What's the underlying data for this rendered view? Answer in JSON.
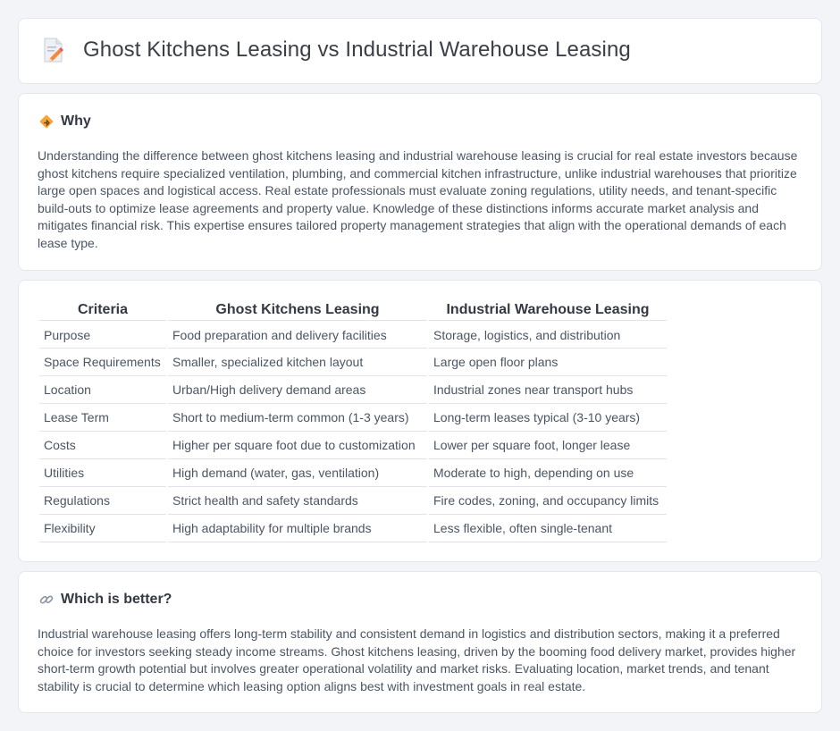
{
  "header": {
    "title": "Ghost Kitchens Leasing vs Industrial Warehouse Leasing",
    "icon": "document-pencil-icon"
  },
  "why": {
    "heading": "Why",
    "icon": "diamond-road-sign-icon",
    "text": "Understanding the difference between ghost kitchens leasing and industrial warehouse leasing is crucial for real estate investors because ghost kitchens require specialized ventilation, plumbing, and commercial kitchen infrastructure, unlike industrial warehouses that prioritize large open spaces and logistical access. Real estate professionals must evaluate zoning regulations, utility needs, and tenant-specific build-outs to optimize lease agreements and property value. Knowledge of these distinctions informs accurate market analysis and mitigates financial risk. This expertise ensures tailored property management strategies that align with the operational demands of each lease type."
  },
  "comparison": {
    "headers": [
      "Criteria",
      "Ghost Kitchens Leasing",
      "Industrial Warehouse Leasing"
    ],
    "rows": [
      [
        "Purpose",
        "Food preparation and delivery facilities",
        "Storage, logistics, and distribution"
      ],
      [
        "Space Requirements",
        "Smaller, specialized kitchen layout",
        "Large open floor plans"
      ],
      [
        "Location",
        "Urban/High delivery demand areas",
        "Industrial zones near transport hubs"
      ],
      [
        "Lease Term",
        "Short to medium-term common (1-3 years)",
        "Long-term leases typical (3-10 years)"
      ],
      [
        "Costs",
        "Higher per square foot due to customization",
        "Lower per square foot, longer lease"
      ],
      [
        "Utilities",
        "High demand (water, gas, ventilation)",
        "Moderate to high, depending on use"
      ],
      [
        "Regulations",
        "Strict health and safety standards",
        "Fire codes, zoning, and occupancy limits"
      ],
      [
        "Flexibility",
        "High adaptability for multiple brands",
        "Less flexible, often single-tenant"
      ]
    ]
  },
  "better": {
    "heading": "Which is better?",
    "icon": "link-icon",
    "text": "Industrial warehouse leasing offers long-term stability and consistent demand in logistics and distribution sectors, making it a preferred choice for investors seeking steady income streams. Ghost kitchens leasing, driven by the booming food delivery market, provides higher short-term growth potential but involves greater operational volatility and market risks. Evaluating location, market trends, and tenant stability is crucial to determine which leasing option aligns best with investment goals in real estate."
  }
}
